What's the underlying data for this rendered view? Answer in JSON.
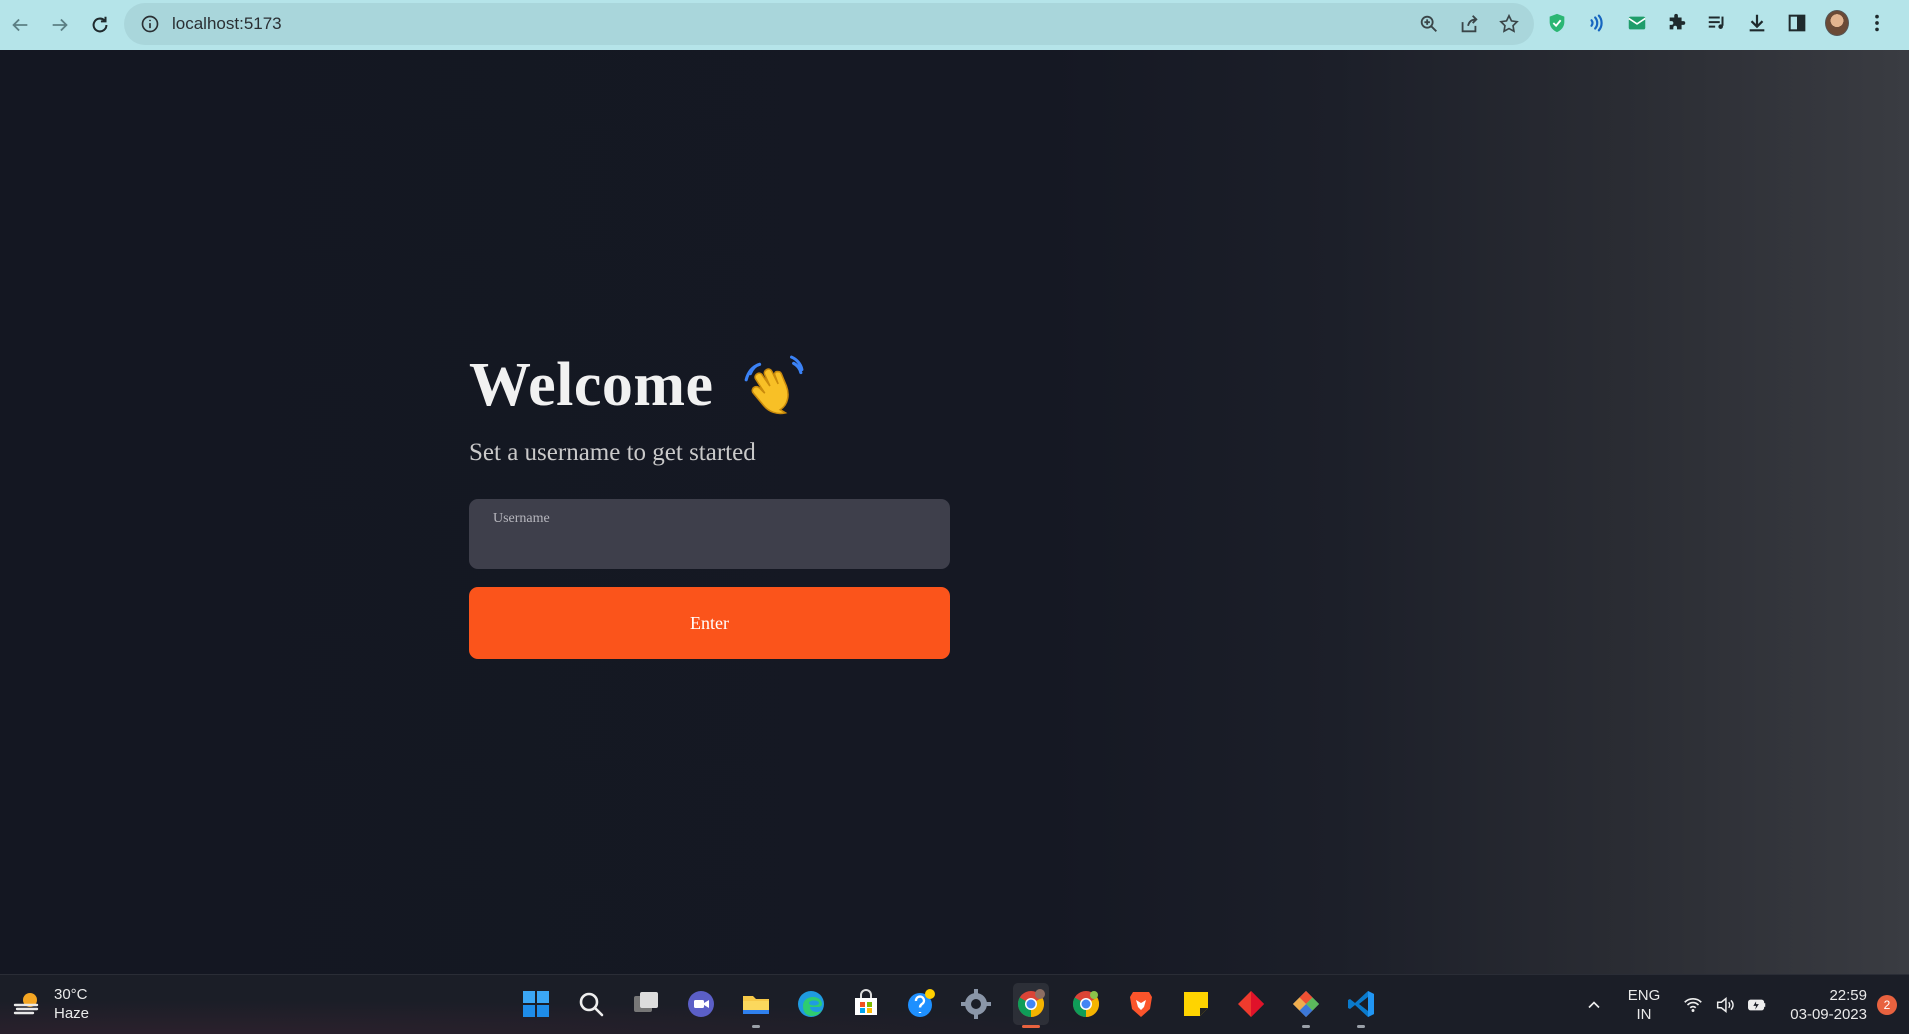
{
  "browser": {
    "url": "localhost:5173"
  },
  "page": {
    "title": "Welcome",
    "subtitle": "Set a username to get started",
    "username_label": "Username",
    "username_value": "",
    "enter_label": "Enter"
  },
  "taskbar": {
    "weather_temp": "30°C",
    "weather_desc": "Haze",
    "lang_top": "ENG",
    "lang_bottom": "IN",
    "time": "22:59",
    "date": "03-09-2023",
    "notification_count": "2"
  },
  "colors": {
    "accent": "#fb541b",
    "chrome_bar": "#b5e4e9",
    "page_bg": "#151821",
    "input_bg": "#3e3f4b"
  }
}
